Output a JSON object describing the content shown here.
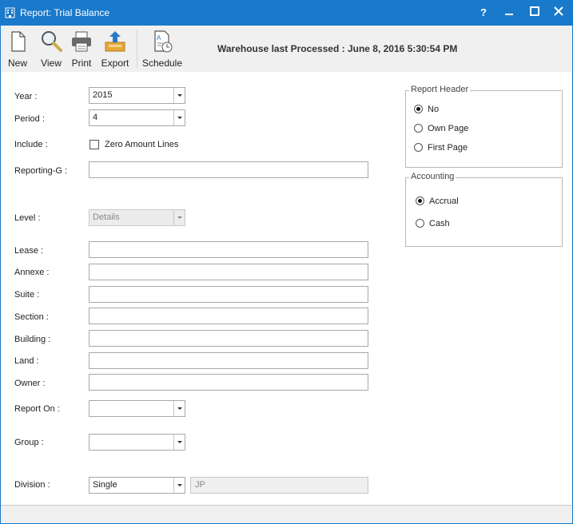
{
  "window": {
    "title": "Report: Trial Balance",
    "accent": "#1979ca"
  },
  "titlebar": {
    "help": "?"
  },
  "toolbar": {
    "new_label": "New",
    "view_label": "View",
    "print_label": "Print",
    "export_label": "Export",
    "schedule_label": "Schedule",
    "warehouse_text": "Warehouse last Processed : June 8, 2016 5:30:54 PM"
  },
  "form": {
    "year": {
      "label": "Year :",
      "value": "2015"
    },
    "period": {
      "label": "Period :",
      "value": "4"
    },
    "include": {
      "label": "Include :",
      "checkbox_label": "Zero Amount Lines",
      "checked": false
    },
    "reporting_g": {
      "label": "Reporting-G :",
      "value": ""
    },
    "level": {
      "label": "Level :",
      "value": "Details"
    },
    "lease": {
      "label": "Lease :",
      "value": ""
    },
    "annexe": {
      "label": "Annexe :",
      "value": ""
    },
    "suite": {
      "label": "Suite :",
      "value": ""
    },
    "section": {
      "label": "Section :",
      "value": ""
    },
    "building": {
      "label": "Building :",
      "value": ""
    },
    "land": {
      "label": "Land :",
      "value": ""
    },
    "owner": {
      "label": "Owner :",
      "value": ""
    },
    "report_on": {
      "label": "Report On :",
      "value": ""
    },
    "group": {
      "label": "Group :",
      "value": ""
    },
    "division": {
      "label": "Division :",
      "value": "Single",
      "code": "JP"
    }
  },
  "report_header": {
    "title": "Report Header",
    "options": [
      "No",
      "Own Page",
      "First Page"
    ],
    "selected": "No"
  },
  "accounting": {
    "title": "Accounting",
    "options": [
      "Accrual",
      "Cash"
    ],
    "selected": "Accrual"
  }
}
